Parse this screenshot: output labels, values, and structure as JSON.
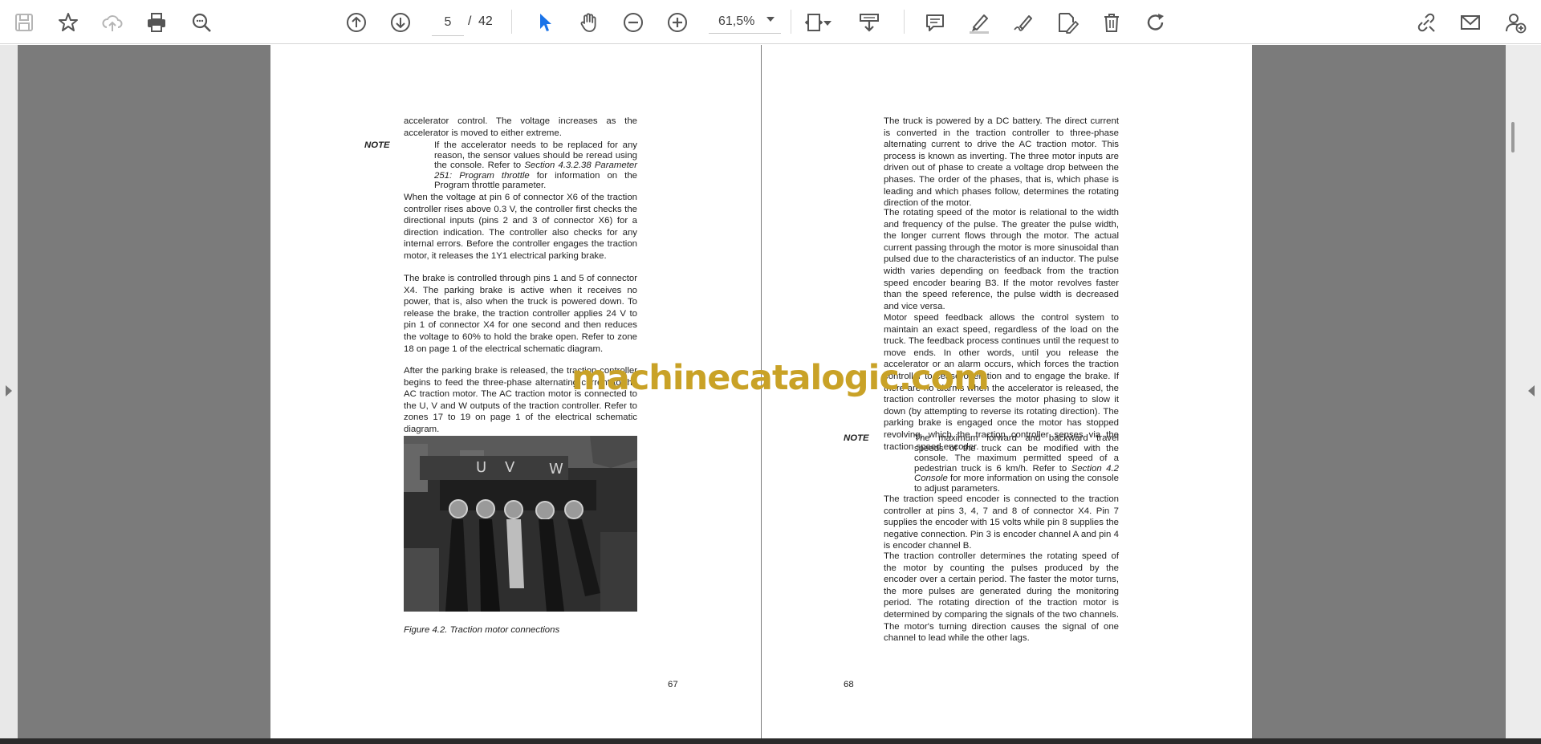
{
  "toolbar": {
    "page_current": "5",
    "page_separator": "/",
    "page_total": "42",
    "zoom": "61,5%",
    "accent_color": "#1a73e8",
    "icons": [
      "save-icon",
      "bookmark-star-icon",
      "cloud-upload-icon",
      "print-icon",
      "zoom-search-icon",
      "page-up-icon",
      "page-down-icon",
      "select-cursor-icon",
      "hand-tool-icon",
      "zoom-out-icon",
      "zoom-in-icon",
      "page-fit-icon",
      "download-scroll-icon",
      "comment-icon",
      "highlight-pen-icon",
      "sign-pen-icon",
      "edit-document-icon",
      "trash-icon",
      "rotate-icon",
      "share-link-icon",
      "email-icon",
      "add-user-icon"
    ]
  },
  "left_page": {
    "para_1": "accelerator control. The voltage increases as the accelerator is moved to either extreme.",
    "note_label": "NOTE",
    "note_text_1": "If the accelerator needs to be replaced for any reason, the sensor values should be reread using the console. Refer to",
    "note_ref": "Section 4.3.2.38 Parameter 251: Program throttle",
    "note_text_2": "for information on the Program throttle parameter.",
    "para_2": "When the voltage at pin 6 of connector X6 of the traction controller rises above 0.3 V, the controller first checks the directional inputs (pins 2 and 3 of connector X6) for a direction indication. The controller also checks for any internal errors. Before the controller engages the traction motor, it releases the 1Y1 electrical parking brake.",
    "para_3": "The brake is controlled through pins 1 and 5 of connector X4. The parking brake is active when it receives no power, that is, also when the truck is powered down. To release the brake, the traction controller applies 24 V to pin 1 of connector X4 for one second and then reduces the voltage to 60% to hold the brake open. Refer to zone 18 on page 1 of the electrical schematic diagram.",
    "para_4": "After the parking brake is released, the traction controller begins to feed the three-phase alternating current to the AC traction motor. The AC traction motor is connected to the U, V and W outputs of the traction controller. Refer to zones 17 to 19 on page 1 of the electrical schematic diagram.",
    "photo_labels": [
      "U",
      "V",
      "W"
    ],
    "caption": "Figure 4.2. Traction motor connections",
    "page_number": "67"
  },
  "right_page": {
    "para_1": "The truck is powered by a DC battery. The direct current is converted in the traction controller to three-phase alternating current to drive the AC traction motor. This process is known as inverting. The three motor inputs are driven out of phase to create a voltage drop between the phases. The order of the phases, that is, which phase is leading and which phases follow, determines the rotating direction of the motor.",
    "para_2": "The rotating speed of the motor is relational to the width and frequency of the pulse. The greater the pulse width, the longer current flows through the motor. The actual current passing through the motor is more sinusoidal than pulsed due to the characteristics of an inductor. The pulse width varies depending on feedback from the traction speed encoder bearing B3. If the motor revolves faster than the speed reference, the pulse width is decreased and vice versa.",
    "para_3": "Motor speed feedback allows the control system to maintain an exact speed, regardless of the load on the truck. The feedback process continues until the request to move ends. In other words, until you release the accelerator or an alarm occurs, which forces the traction controller to cease operation and to engage the brake. If there are no alarms when the accelerator is released, the traction controller reverses the motor phasing to slow it down (by attempting to reverse its rotating direction). The parking brake is engaged once the motor has stopped revolving, which the traction controller senses via the traction speed encoder.",
    "note_label": "NOTE",
    "note_text_1": "The maximum forward and backward travel speeds of the truck can be modified with the console. The maximum permitted speed of a pedestrian truck is 6 km/h. Refer to",
    "note_ref": "Section 4.2 Console",
    "note_text_2": "for more information on using the console to adjust parameters.",
    "para_4": "The traction speed encoder is connected to the traction controller at pins 3, 4, 7 and 8 of connector X4. Pin 7 supplies the encoder with 15 volts while pin 8 supplies the negative connection. Pin 3 is encoder channel A and pin 4 is encoder channel B.",
    "para_5": "The traction controller determines the rotating speed of the motor by counting the pulses produced by the encoder over a certain period. The faster the motor turns, the more pulses are generated during the monitoring period. The rotating direction of the traction motor is determined by comparing the signals of the two channels. The motor's turning direction causes the signal of one channel to lead while the other lags.",
    "page_number": "68"
  },
  "watermark": "machinecatalogic.com"
}
